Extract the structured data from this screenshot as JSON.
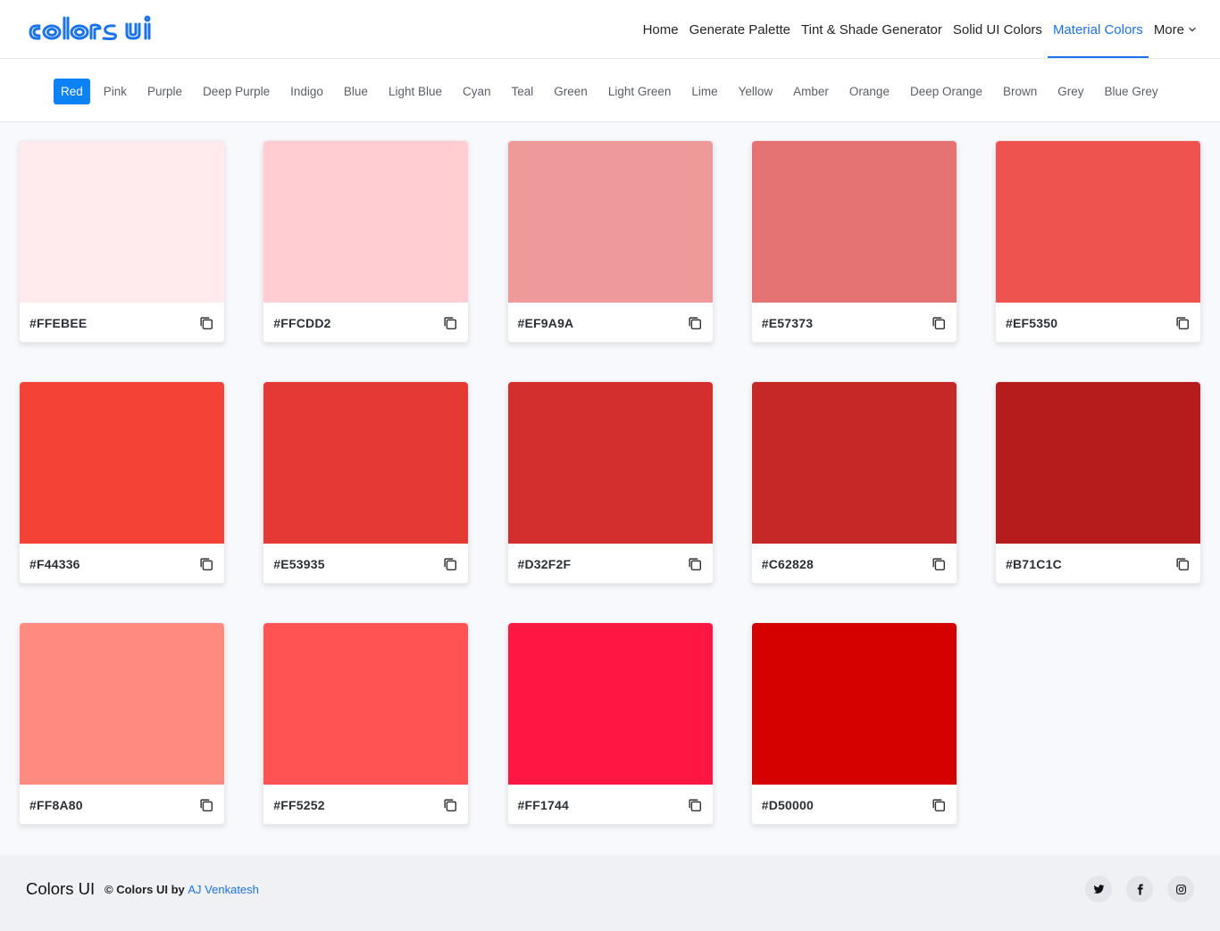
{
  "header": {
    "logo_alt": "colors ui",
    "nav": [
      {
        "label": "Home"
      },
      {
        "label": "Generate Palette"
      },
      {
        "label": "Tint & Shade Generator"
      },
      {
        "label": "Solid UI Colors"
      },
      {
        "label": "Material Colors",
        "active": true
      },
      {
        "label": "More"
      }
    ],
    "accent_color": "#1a73e8"
  },
  "color_tabs": {
    "items": [
      "Red",
      "Pink",
      "Purple",
      "Deep Purple",
      "Indigo",
      "Blue",
      "Light Blue",
      "Cyan",
      "Teal",
      "Green",
      "Light Green",
      "Lime",
      "Yellow",
      "Amber",
      "Orange",
      "Deep Orange",
      "Brown",
      "Grey",
      "Blue Grey"
    ],
    "active": "Red",
    "active_color": "#0d82f5"
  },
  "swatches": [
    {
      "hex": "#FFEBEE",
      "color": "#FFEBEE"
    },
    {
      "hex": "#FFCDD2",
      "color": "#FFCDD2"
    },
    {
      "hex": "#EF9A9A",
      "color": "#EF9A9A"
    },
    {
      "hex": "#E57373",
      "color": "#E57373"
    },
    {
      "hex": "#EF5350",
      "color": "#EF5350"
    },
    {
      "hex": "#F44336",
      "color": "#F44336"
    },
    {
      "hex": "#E53935",
      "color": "#E53935"
    },
    {
      "hex": "#D32F2F",
      "color": "#D32F2F"
    },
    {
      "hex": "#C62828",
      "color": "#C62828"
    },
    {
      "hex": "#B71C1C",
      "color": "#B71C1C"
    },
    {
      "hex": "#FF8A80",
      "color": "#FF8A80"
    },
    {
      "hex": "#FF5252",
      "color": "#FF5252"
    },
    {
      "hex": "#FF1744",
      "color": "#FF1744"
    },
    {
      "hex": "#D50000",
      "color": "#D50000"
    }
  ],
  "footer": {
    "brand": "Colors UI",
    "credit_prefix": "© Colors UI by",
    "author": "AJ Venkatesh",
    "socials": [
      {
        "name": "twitter-icon"
      },
      {
        "name": "facebook-icon"
      },
      {
        "name": "instagram-icon"
      }
    ]
  }
}
